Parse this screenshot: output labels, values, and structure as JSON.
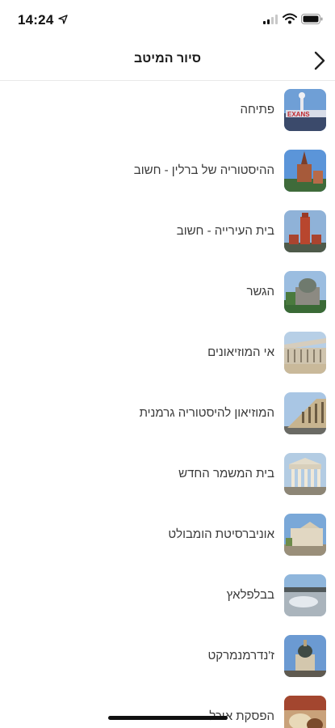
{
  "status_bar": {
    "time": "14:24",
    "icons": [
      "location-arrow-icon",
      "cellular-signal-icon",
      "wifi-icon",
      "battery-icon"
    ]
  },
  "header": {
    "title": "סיור המיטב",
    "back_icon": "chevron-icon"
  },
  "items": [
    {
      "label": "פתיחה",
      "thumb": "sign"
    },
    {
      "label": "ההיסטוריה של ברלין - חשוב",
      "thumb": "church"
    },
    {
      "label": "בית העירייה - חשוב",
      "thumb": "tower"
    },
    {
      "label": "הגשר",
      "thumb": "cathedral"
    },
    {
      "label": "אי המוזיאונים",
      "thumb": "museum"
    },
    {
      "label": "המוזיאון להיסטוריה גרמנית",
      "thumb": "building"
    },
    {
      "label": "בית המשמר החדש",
      "thumb": "portico"
    },
    {
      "label": "אוניברסיטת הומבולט",
      "thumb": "university"
    },
    {
      "label": "בבלפלאץ",
      "thumb": "square"
    },
    {
      "label": "ז'נדרמנמרקט",
      "thumb": "dome"
    },
    {
      "label": "הפסקת אוכל",
      "thumb": "food"
    }
  ],
  "colors": {
    "text": "#3a3a3a",
    "title": "#1a1a1a",
    "divider": "#e9e9e9"
  }
}
